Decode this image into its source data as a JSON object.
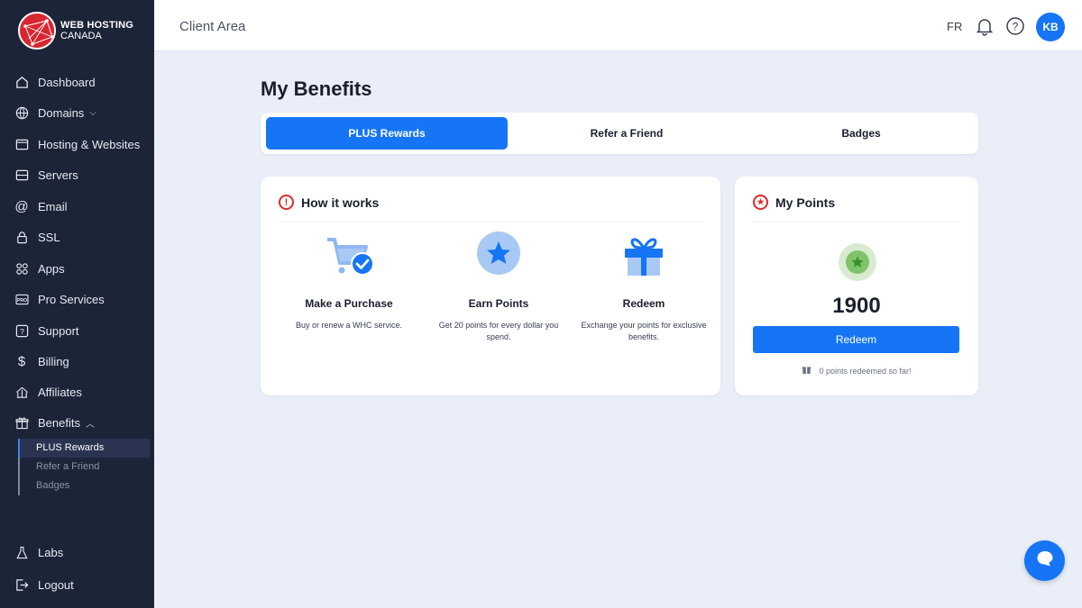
{
  "brand": {
    "line1": "WEB HOSTING",
    "line2": "CANADA"
  },
  "sidebar": {
    "items": [
      {
        "label": "Dashboard",
        "icon": "home-icon"
      },
      {
        "label": "Domains",
        "icon": "globe-icon"
      },
      {
        "label": "Hosting & Websites",
        "icon": "browser-icon"
      },
      {
        "label": "Servers",
        "icon": "server-icon"
      },
      {
        "label": "Email",
        "icon": "at-icon"
      },
      {
        "label": "SSL",
        "icon": "lock-icon"
      },
      {
        "label": "Apps",
        "icon": "apps-icon"
      },
      {
        "label": "Pro Services",
        "icon": "pro-icon"
      },
      {
        "label": "Support",
        "icon": "question-icon"
      },
      {
        "label": "Billing",
        "icon": "dollar-icon"
      },
      {
        "label": "Affiliates",
        "icon": "affiliates-icon"
      },
      {
        "label": "Benefits",
        "icon": "gift-icon"
      },
      {
        "label": "Labs",
        "icon": "flask-icon"
      },
      {
        "label": "Logout",
        "icon": "logout-icon"
      }
    ],
    "benefits_sub": [
      "PLUS Rewards",
      "Refer a Friend",
      "Badges"
    ]
  },
  "header": {
    "title": "Client Area",
    "lang": "FR",
    "avatar_initials": "KB"
  },
  "page": {
    "title": "My Benefits"
  },
  "tabs": [
    "PLUS Rewards",
    "Refer a Friend",
    "Badges"
  ],
  "how_it_works": {
    "title": "How it works",
    "steps": [
      {
        "title": "Make a Purchase",
        "desc": "Buy or renew a WHC service."
      },
      {
        "title": "Earn Points",
        "desc": "Get 20 points for every dollar you spend."
      },
      {
        "title": "Redeem",
        "desc": "Exchange your points for exclusive benefits."
      }
    ]
  },
  "my_points": {
    "title": "My Points",
    "value": "1900",
    "button": "Redeem",
    "note": "0 points redeemed so far!"
  },
  "colors": {
    "primary": "#1575f5",
    "sidebar": "#1c2438",
    "accent_red": "#e02a2a"
  }
}
